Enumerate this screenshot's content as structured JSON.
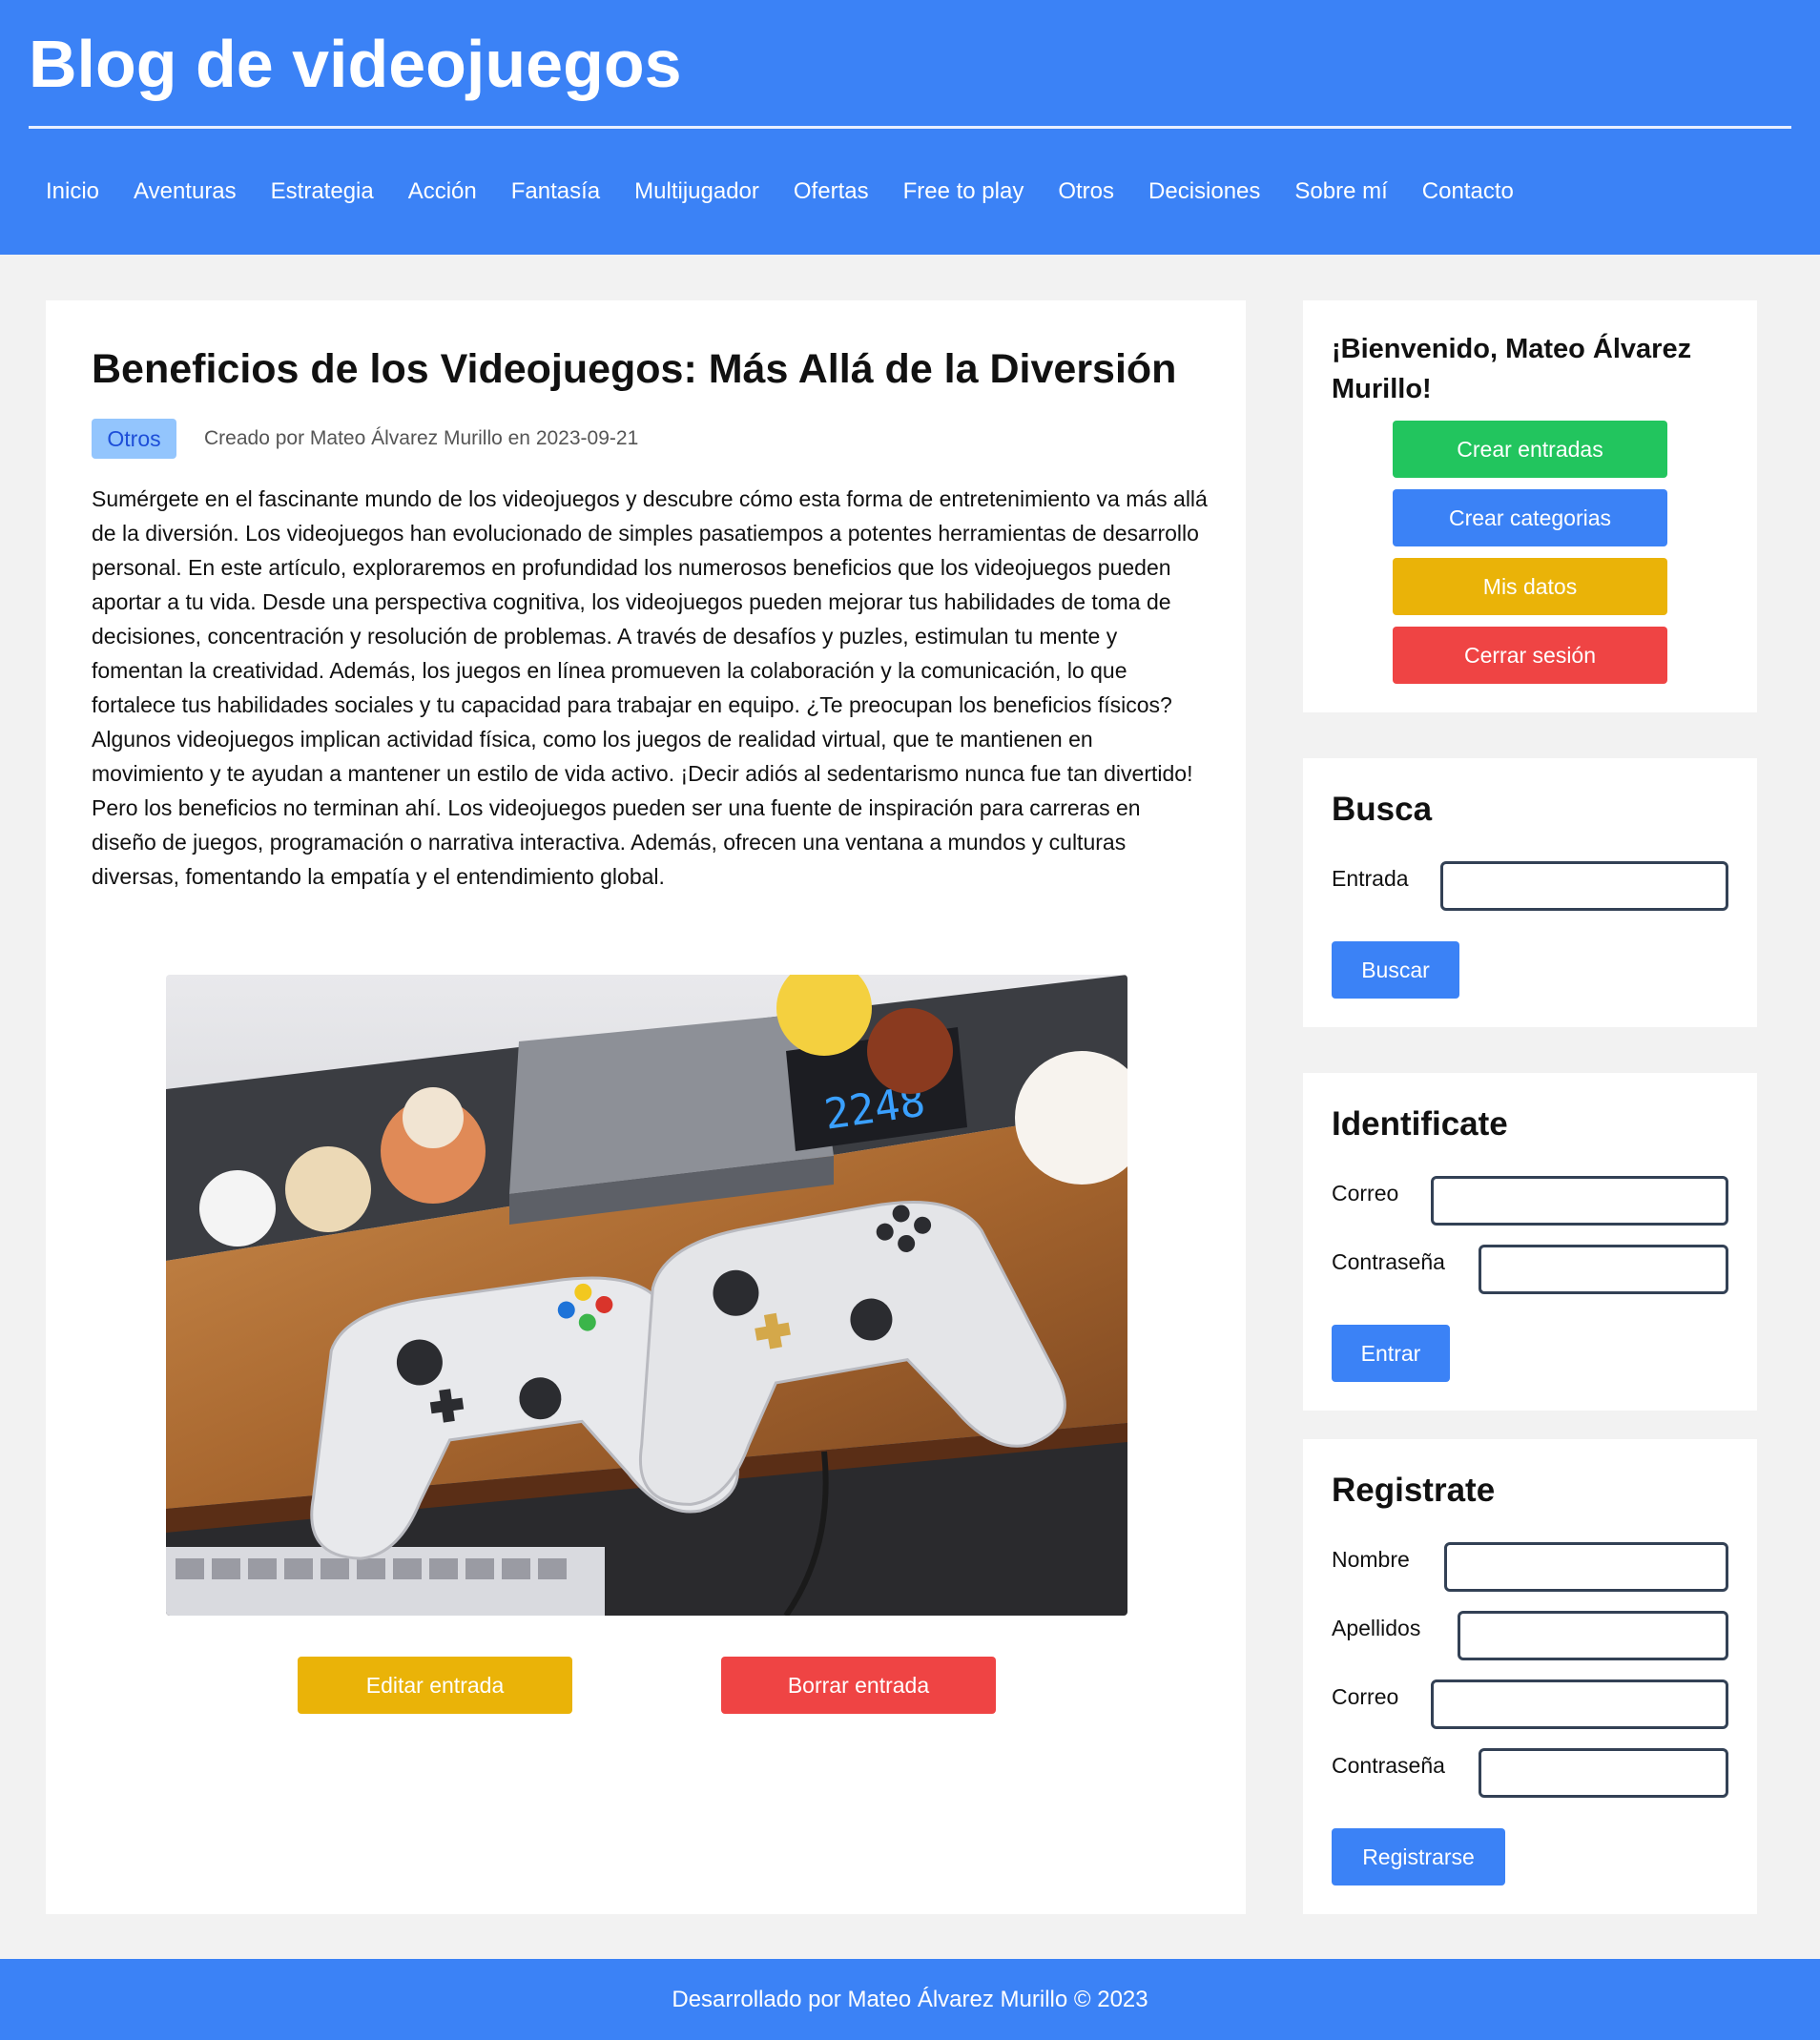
{
  "header": {
    "site_title": "Blog de videojuegos",
    "nav": [
      "Inicio",
      "Aventuras",
      "Estrategia",
      "Acción",
      "Fantasía",
      "Multijugador",
      "Ofertas",
      "Free to play",
      "Otros",
      "Decisiones",
      "Sobre mí",
      "Contacto"
    ]
  },
  "post": {
    "title": "Beneficios de los Videojuegos: Más Allá de la Diversión",
    "category": "Otros",
    "meta": "Creado por Mateo Álvarez Murillo en 2023-09-21",
    "body": "Sumérgete en el fascinante mundo de los videojuegos y descubre cómo esta forma de entretenimiento va más allá de la diversión. Los videojuegos han evolucionado de simples pasatiempos a potentes herramientas de desarrollo personal. En este artículo, exploraremos en profundidad los numerosos beneficios que los videojuegos pueden aportar a tu vida. Desde una perspectiva cognitiva, los videojuegos pueden mejorar tus habilidades de toma de decisiones, concentración y resolución de problemas. A través de desafíos y puzles, estimulan tu mente y fomentan la creatividad. Además, los juegos en línea promueven la colaboración y la comunicación, lo que fortalece tus habilidades sociales y tu capacidad para trabajar en equipo. ¿Te preocupan los beneficios físicos? Algunos videojuegos implican actividad física, como los juegos de realidad virtual, que te mantienen en movimiento y te ayudan a mantener un estilo de vida activo. ¡Decir adiós al sedentarismo nunca fue tan divertido! Pero los beneficios no terminan ahí. Los videojuegos pueden ser una fuente de inspiración para carreras en diseño de juegos, programación o narrativa interactiva. Además, ofrecen una ventana a mundos y culturas diversas, fomentando la empatía y el entendimiento global.",
    "clock_digits": "2248",
    "edit_label": "Editar entrada",
    "delete_label": "Borrar entrada"
  },
  "sidebar": {
    "welcome": "¡Bienvenido, Mateo Álvarez Murillo!",
    "create_post_label": "Crear entradas",
    "create_category_label": "Crear categorias",
    "my_data_label": "Mis datos",
    "logout_label": "Cerrar sesión",
    "search": {
      "title": "Busca",
      "label": "Entrada",
      "value": "",
      "button": "Buscar"
    },
    "login": {
      "title": "Identificate",
      "email_label": "Correo",
      "password_label": "Contraseña",
      "button": "Entrar"
    },
    "register": {
      "title": "Registrate",
      "name_label": "Nombre",
      "surname_label": "Apellidos",
      "email_label": "Correo",
      "password_label": "Contraseña",
      "button": "Registrarse"
    }
  },
  "footer": {
    "text": "Desarrollado por Mateo Álvarez Murillo © 2023"
  },
  "colors": {
    "primary": "#3b82f6",
    "success": "#22c55e",
    "warning": "#eab308",
    "danger": "#ef4444",
    "badge_bg": "#93c5fd"
  }
}
